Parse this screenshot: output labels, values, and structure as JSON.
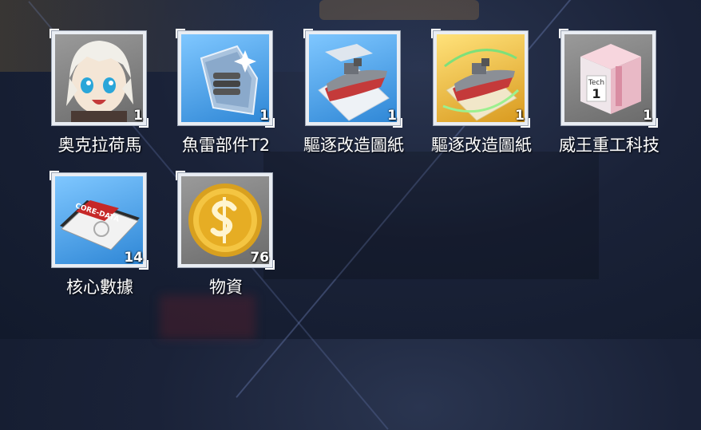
{
  "items": [
    {
      "name": "奥克拉荷馬",
      "count": "1",
      "rarity": "gray",
      "icon": "character-portrait-icon"
    },
    {
      "name": "魚雷部件T2",
      "count": "1",
      "rarity": "blue",
      "icon": "torpedo-part-icon"
    },
    {
      "name": "驅逐改造圖紙",
      "count": "1",
      "rarity": "blue",
      "icon": "destroyer-blueprint-icon"
    },
    {
      "name": "驅逐改造圖紙",
      "count": "1",
      "rarity": "gold",
      "icon": "destroyer-blueprint-gold-icon"
    },
    {
      "name": "威王重工科技",
      "count": "1",
      "rarity": "gray",
      "icon": "tech-box-icon"
    },
    {
      "name": "核心數據",
      "count": "14",
      "rarity": "blue",
      "icon": "core-data-icon"
    },
    {
      "name": "物資",
      "count": "76",
      "rarity": "gray",
      "icon": "coin-icon"
    }
  ],
  "core_data_tag": "CORE-DATA",
  "tech_box_text": "Tech",
  "tech_box_number": "1"
}
